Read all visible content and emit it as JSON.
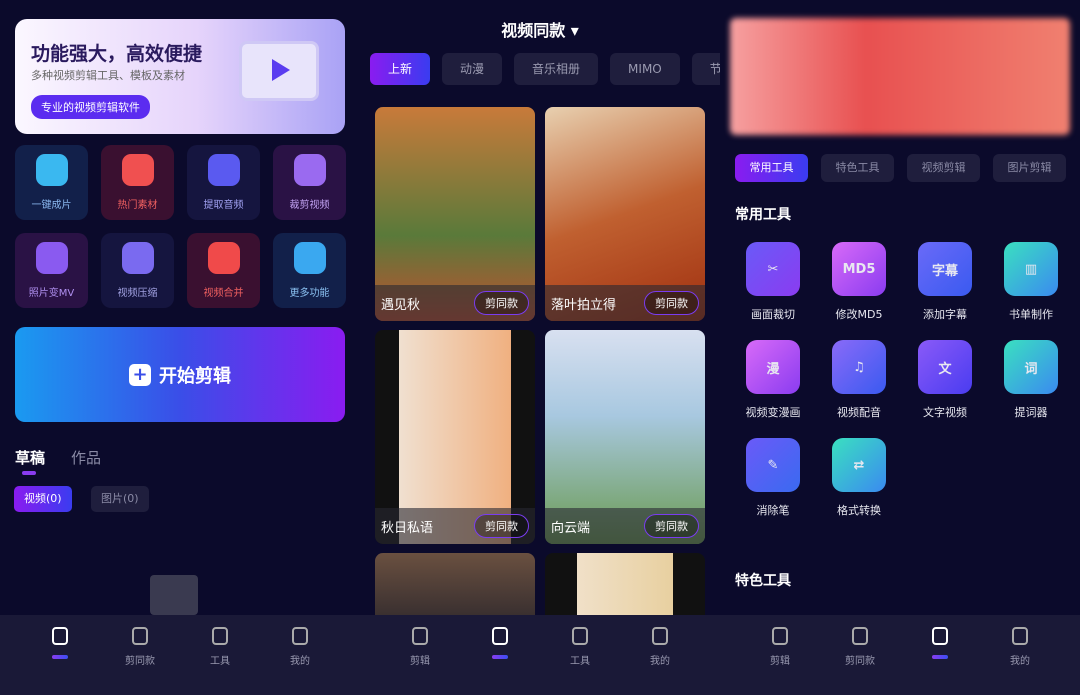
{
  "editor": {
    "banner": {
      "title": "功能强大，高效便捷",
      "subtitle": "多种视频剪辑工具、模板及素材",
      "pill": "专业的视频剪辑软件"
    },
    "tiles": [
      {
        "label": "一键成片",
        "bg": "#12204a",
        "ic": "#3ab8f0",
        "fg": "#8ab8f0",
        "icon": "film-reel-icon"
      },
      {
        "label": "热门素材",
        "bg": "#3a1030",
        "ic": "#f05050",
        "fg": "#f06060",
        "icon": "play-stack-icon"
      },
      {
        "label": "提取音频",
        "bg": "#15153f",
        "ic": "#5a5af0",
        "fg": "#a0a0f0",
        "icon": "audio-extract-icon"
      },
      {
        "label": "裁剪视频",
        "bg": "#2a1245",
        "ic": "#9a6af0",
        "fg": "#c0a0f0",
        "icon": "scissors-film-icon"
      },
      {
        "label": "照片变MV",
        "bg": "#2a1245",
        "ic": "#8a5af0",
        "fg": "#b090f0",
        "icon": "mv-clapper-icon"
      },
      {
        "label": "视频压缩",
        "bg": "#15153f",
        "ic": "#7a6af0",
        "fg": "#a0a0e0",
        "icon": "zip-camera-icon"
      },
      {
        "label": "视频合并",
        "bg": "#3a1030",
        "ic": "#f04a4a",
        "fg": "#f06060",
        "icon": "merge-clapper-icon"
      },
      {
        "label": "更多功能",
        "bg": "#12204a",
        "ic": "#3aa8f0",
        "fg": "#8ac0f0",
        "icon": "grid-more-icon"
      }
    ],
    "start_label": "开始剪辑",
    "tabs": [
      "草稿",
      "作品"
    ],
    "chips": [
      "视频(0)",
      "图片(0)"
    ]
  },
  "templates": {
    "title": "视频同款",
    "tabs": [
      "上新",
      "动漫",
      "音乐相册",
      "MIMO",
      "节日"
    ],
    "cards": [
      {
        "title": "遇见秋",
        "button": "剪同款",
        "bg": "linear-gradient(180deg,#c87a3a,#5a7a3a 60%,#c05030)"
      },
      {
        "title": "落叶拍立得",
        "button": "剪同款",
        "bg": "linear-gradient(160deg,#e8d0b0,#c06030 50%,#a03010)"
      },
      {
        "title": "秋日私语",
        "button": "剪同款",
        "bg": "linear-gradient(90deg,#111 15%,#f0e0d0 15%,#f0b080 85%,#111 85%)"
      },
      {
        "title": "向云端",
        "button": "剪同款",
        "bg": "linear-gradient(180deg,#d8e0f0,#a8c8e0 40%,#6a9a50)"
      },
      {
        "title": "",
        "button": "",
        "bg": "linear-gradient(180deg,#6a5040,#3a3030)"
      },
      {
        "title": "",
        "button": "",
        "bg": "linear-gradient(90deg,#111 20%,#f0e0c8 20%,#e8d0a0 80%,#111 80%)"
      }
    ]
  },
  "tools": {
    "tabs": [
      "常用工具",
      "特色工具",
      "视频剪辑",
      "图片剪辑"
    ],
    "section1": "常用工具",
    "section2": "特色工具",
    "items": [
      {
        "label": "画面裁切",
        "glyph": "✂",
        "bg": "linear-gradient(135deg,#6a5af8,#8a3cf0)",
        "icon": "crop-icon"
      },
      {
        "label": "修改MD5",
        "glyph": "MD5",
        "bg": "linear-gradient(135deg,#d86af8,#8a3cf0)",
        "icon": "md5-icon"
      },
      {
        "label": "添加字幕",
        "glyph": "字幕",
        "bg": "linear-gradient(135deg,#6a6af8,#3a5af0)",
        "icon": "subtitle-icon"
      },
      {
        "label": "书单制作",
        "glyph": "▥",
        "bg": "linear-gradient(135deg,#3ae0c0,#3a8af0)",
        "icon": "book-icon"
      },
      {
        "label": "视频变漫画",
        "glyph": "漫",
        "bg": "linear-gradient(135deg,#d86af8,#8a3cf0)",
        "icon": "comic-icon"
      },
      {
        "label": "视频配音",
        "glyph": "♫",
        "bg": "linear-gradient(135deg,#8a6af8,#3a5af0)",
        "icon": "dubbing-icon"
      },
      {
        "label": "文字视频",
        "glyph": "文",
        "bg": "linear-gradient(135deg,#8a5af8,#4a3cf0)",
        "icon": "text-video-icon"
      },
      {
        "label": "提词器",
        "glyph": "词",
        "bg": "linear-gradient(135deg,#3ae0c0,#3a8af0)",
        "icon": "teleprompter-icon"
      },
      {
        "label": "消除笔",
        "glyph": "✎",
        "bg": "linear-gradient(135deg,#6a5af8,#3a6af0)",
        "icon": "eraser-brush-icon"
      },
      {
        "label": "格式转换",
        "glyph": "⇄",
        "bg": "linear-gradient(135deg,#3ae0c0,#3a8af0)",
        "icon": "format-convert-icon"
      }
    ]
  },
  "nav": [
    "剪辑",
    "剪同款",
    "工具",
    "我的"
  ]
}
